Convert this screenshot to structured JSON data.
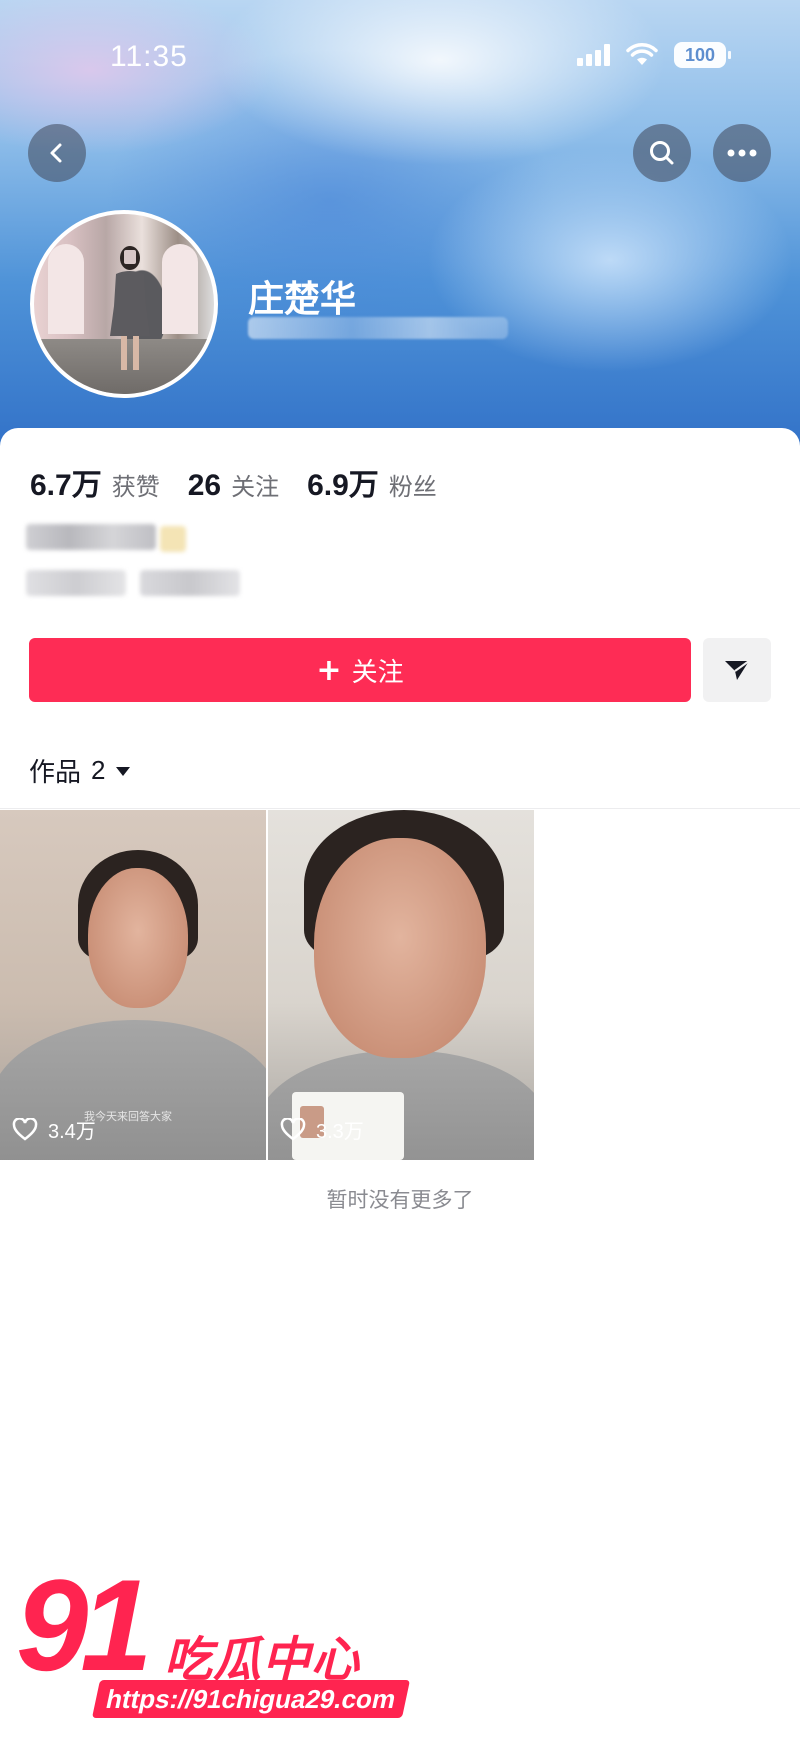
{
  "status_bar": {
    "time": "11:35",
    "battery": "100"
  },
  "header": {
    "back_icon": "chevron-left-icon",
    "search_icon": "search-icon",
    "more_icon": "more-horizontal-icon"
  },
  "profile": {
    "name": "庄楚华",
    "stats": [
      {
        "number": "6.7万",
        "label": "获赞"
      },
      {
        "number": "26",
        "label": "关注"
      },
      {
        "number": "6.9万",
        "label": "粉丝"
      }
    ],
    "follow_label": "关注",
    "follow_icon": "plus-icon",
    "share_icon": "send-icon"
  },
  "works": {
    "tab_label": "作品",
    "count": "2",
    "dropdown_icon": "caret-down-icon",
    "videos": [
      {
        "likes": "3.4万",
        "caption": "我今天来回答大家"
      },
      {
        "likes": "3.3万",
        "caption": ""
      }
    ],
    "empty_text": "暂时没有更多了"
  },
  "watermark": {
    "number": "91",
    "title": "吃瓜中心",
    "url": "https://91chigua29.com"
  },
  "colors": {
    "accent": "#fe2c55",
    "banner": "#4f93d8"
  }
}
